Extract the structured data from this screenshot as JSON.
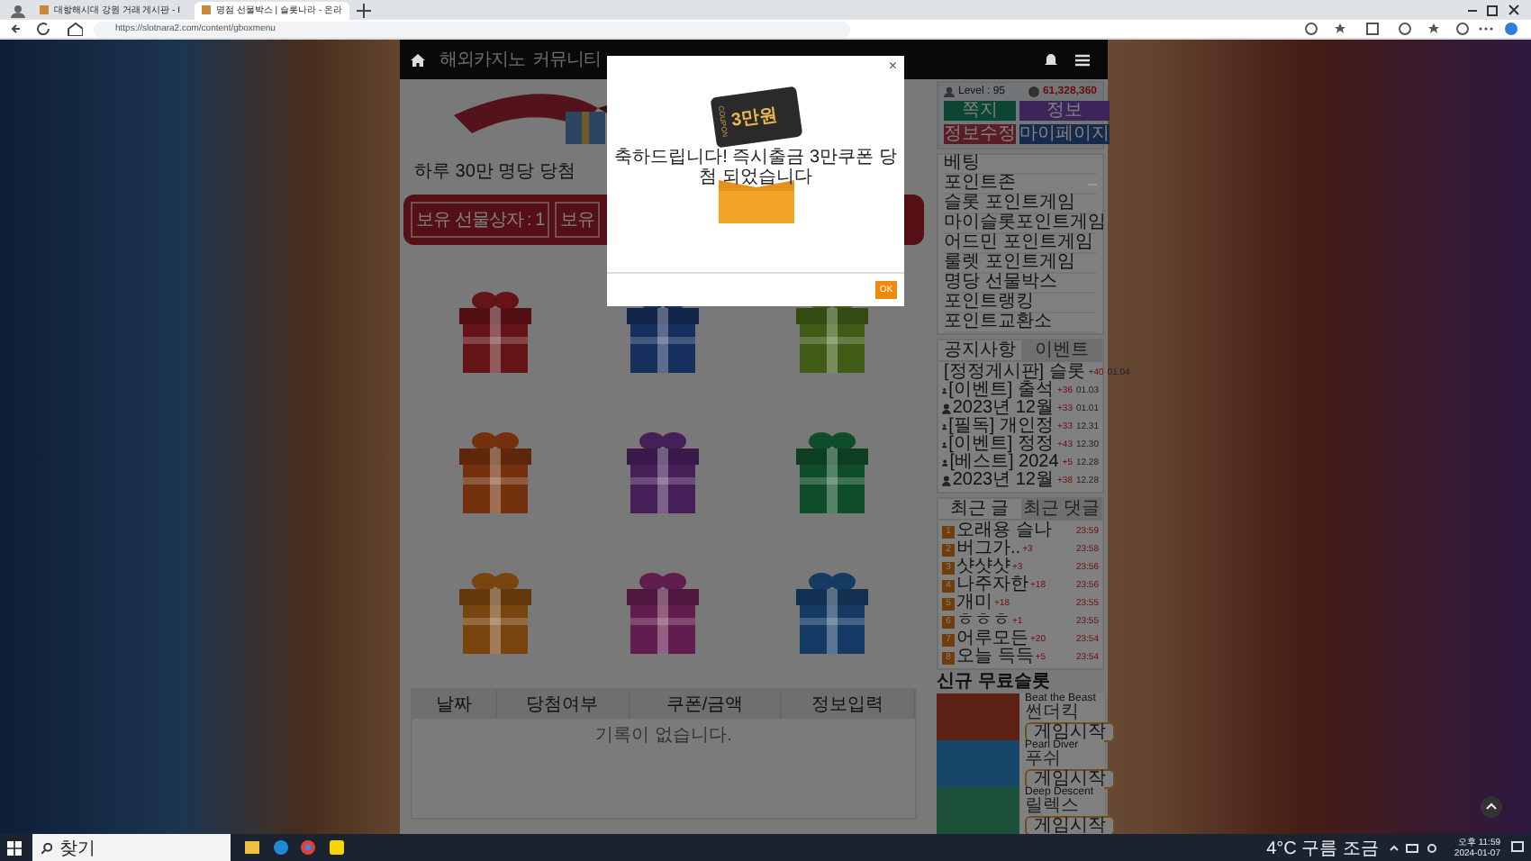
{
  "browser": {
    "tabs": [
      {
        "title": "대항해시대 강원 거래 게시판 - I",
        "selected": false
      },
      {
        "title": "명점 선물박스 | 슬롯나라 - 온라",
        "selected": true
      }
    ],
    "url": "https://slotnara2.com/content/gboxmenu"
  },
  "nav": {
    "items": [
      "해외카지노",
      "커뮤니티"
    ]
  },
  "event": {
    "caption": "하루 30만 명당 당첨",
    "counters": [
      "보유 선물상자 : 1",
      "보유"
    ]
  },
  "gifts": [
    {
      "color": "#641317"
    },
    {
      "color": "#172f5c"
    },
    {
      "color": "#3f5b16"
    },
    {
      "color": "#74310e"
    },
    {
      "color": "#451f58"
    },
    {
      "color": "#0f4d2a"
    },
    {
      "color": "#78450f"
    },
    {
      "color": "#611d4d"
    },
    {
      "color": "#153b64"
    }
  ],
  "history_table": {
    "columns": [
      "날짜",
      "당첨여부",
      "쿠폰/금액",
      "정보입력"
    ],
    "empty_text": "기록이 없습니다."
  },
  "user": {
    "level": "Level : 95",
    "points": "61,328,360",
    "buttons": [
      {
        "label": "쪽지",
        "color": "#0d4535"
      },
      {
        "label": "정보",
        "color": "#3d2559"
      },
      {
        "label": "정보수정",
        "color": "#581d26"
      },
      {
        "label": "마이페이지",
        "color": "#172a4b"
      }
    ]
  },
  "menu": [
    {
      "label": "베팅"
    },
    {
      "label": "포인트존",
      "expanded": true,
      "children": [
        {
          "label": "슬롯 포인트게임"
        },
        {
          "label": "마이슬롯포인트게임"
        },
        {
          "label": "어드민 포인트게임"
        },
        {
          "label": "룰렛 포인트게임"
        },
        {
          "label": "명당 선물박스"
        },
        {
          "label": "포인트랭킹"
        },
        {
          "label": "포인트교환소"
        }
      ]
    }
  ],
  "notice_tabs": [
    {
      "label": "공지사항",
      "selected": true
    },
    {
      "label": "이벤트",
      "selected": false
    }
  ],
  "notices": [
    {
      "title": "[정정게시판] 슬롯",
      "count": "+40",
      "date": "01.04"
    },
    {
      "title": "[이벤트] 출석",
      "count": "+36",
      "date": "01.03"
    },
    {
      "title": "2023년 12월",
      "count": "+33",
      "date": "01.01"
    },
    {
      "title": "[필독] 개인정",
      "count": "+33",
      "date": "12.31"
    },
    {
      "title": "[이벤트] 정정",
      "count": "+43",
      "date": "12.30"
    },
    {
      "title": "[베스트] 2024",
      "count": "+5",
      "date": "12.28"
    },
    {
      "title": "2023년 12월",
      "count": "+38",
      "date": "12.28"
    }
  ],
  "recent_tabs": [
    {
      "label": "최근 글",
      "selected": true
    },
    {
      "label": "최근 댓글",
      "selected": false
    }
  ],
  "recent_posts": [
    {
      "rank": "1",
      "title": "오래용 슬나",
      "time": "23:59"
    },
    {
      "rank": "2",
      "title": "버그가..",
      "count": "+3",
      "time": "23:58"
    },
    {
      "rank": "3",
      "title": "샷샷샷",
      "count": "+3",
      "time": "23:56"
    },
    {
      "rank": "4",
      "title": "나주자한",
      "count": "+18",
      "time": "23:56"
    },
    {
      "rank": "5",
      "title": "개미",
      "count": "+18",
      "time": "23:55"
    },
    {
      "rank": "6",
      "title": "ㅎㅎㅎ",
      "count": "+1",
      "time": "23:55"
    },
    {
      "rank": "7",
      "title": "어루모든",
      "count": "+20",
      "time": "23:54"
    },
    {
      "rank": "8",
      "title": "오늘 득득",
      "count": "+5",
      "time": "23:54"
    }
  ],
  "free_slots": {
    "title": "신규 무료슬롯",
    "games": [
      {
        "name": "Beat the Beast",
        "provider": "썬더킥",
        "button": "게임시작",
        "color": "#5c2015"
      },
      {
        "name": "Pearl Diver",
        "provider": "푸쉬",
        "button": "게임시작",
        "color": "#174768"
      },
      {
        "name": "Deep Descent",
        "provider": "릴렉스",
        "button": "게임시작",
        "color": "#1d5038"
      }
    ]
  },
  "modal": {
    "close": "×",
    "coupon_label": "COUPON",
    "coupon_amount": "3만원",
    "message": "축하드립니다! 즉시출금 3만쿠폰 당첨 되었습니다",
    "ok": "OK"
  },
  "taskbar": {
    "search": "찾기",
    "weather": "4°C 구름 조금",
    "time": "오후 11:59",
    "date": "2024-01-07"
  }
}
